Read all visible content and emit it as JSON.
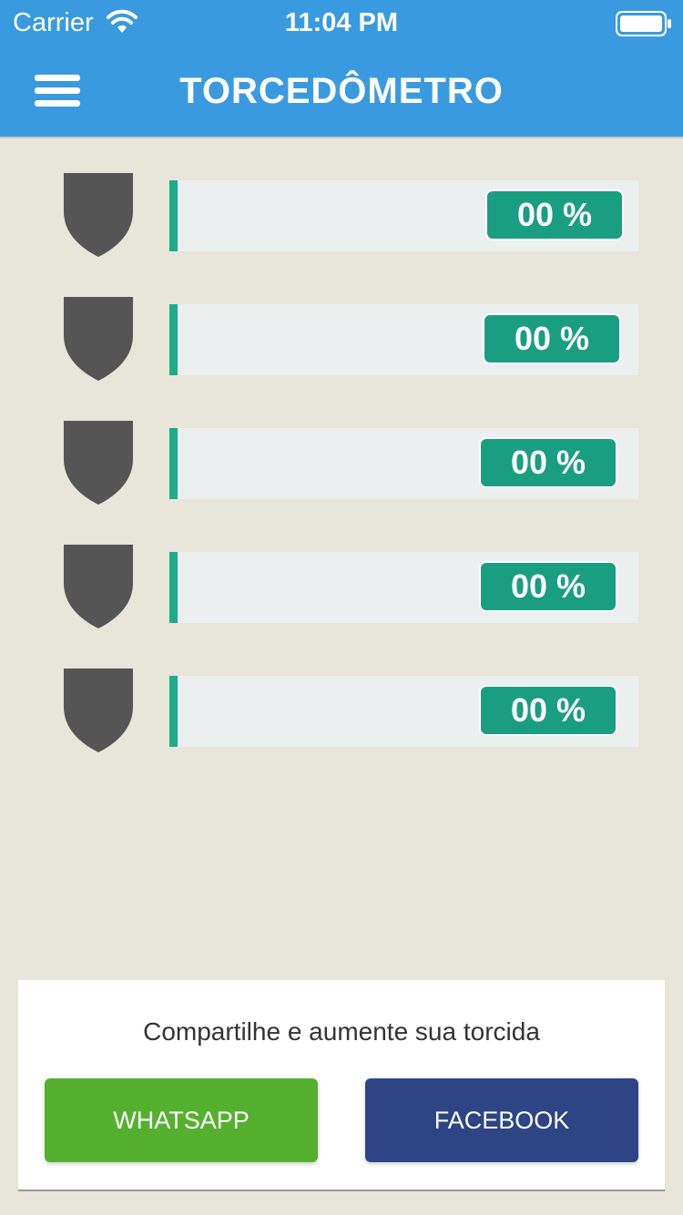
{
  "status_bar": {
    "carrier": "Carrier",
    "time": "11:04 PM"
  },
  "header": {
    "title": "TORCEDÔMETRO",
    "menu_icon": "hamburger-menu-icon"
  },
  "rows": [
    {
      "percent_label": "00 %",
      "percent_value": 0,
      "shield_icon": "shield-icon"
    },
    {
      "percent_label": "00 %",
      "percent_value": 0,
      "shield_icon": "shield-icon"
    },
    {
      "percent_label": "00 %",
      "percent_value": 0,
      "shield_icon": "shield-icon"
    },
    {
      "percent_label": "00 %",
      "percent_value": 0,
      "shield_icon": "shield-icon"
    },
    {
      "percent_label": "00 %",
      "percent_value": 0,
      "shield_icon": "shield-icon"
    }
  ],
  "share": {
    "text": "Compartilhe e aumente sua torcida",
    "whatsapp_label": "WHATSAPP",
    "facebook_label": "FACEBOOK"
  },
  "colors": {
    "header": "#3a9ae0",
    "background": "#e8e5d9",
    "accent": "#1aae8c",
    "badge": "#1a9e82",
    "shield": "#555555",
    "whatsapp": "#56b02f",
    "facebook": "#2d4584"
  }
}
